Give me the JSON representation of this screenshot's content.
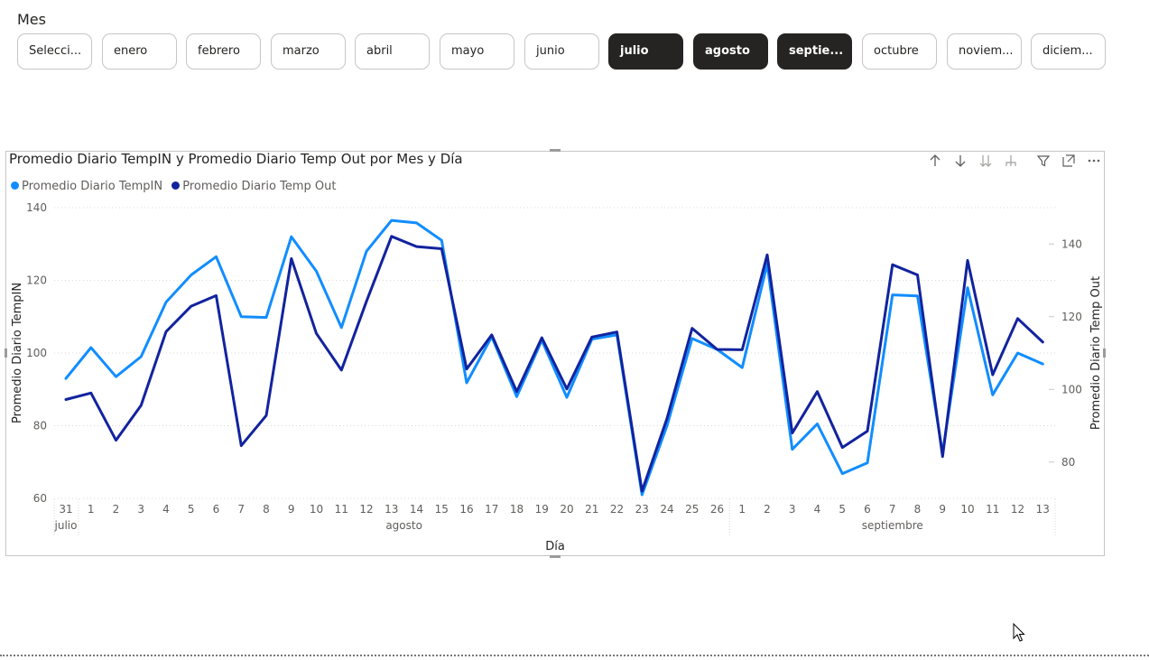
{
  "slicer": {
    "title": "Mes",
    "items": [
      {
        "label": "Selecci...",
        "selected": false
      },
      {
        "label": "enero",
        "selected": false
      },
      {
        "label": "febrero",
        "selected": false
      },
      {
        "label": "marzo",
        "selected": false
      },
      {
        "label": "abril",
        "selected": false
      },
      {
        "label": "mayo",
        "selected": false
      },
      {
        "label": "junio",
        "selected": false
      },
      {
        "label": "julio",
        "selected": true
      },
      {
        "label": "agosto",
        "selected": true
      },
      {
        "label": "septie...",
        "selected": true
      },
      {
        "label": "octubre",
        "selected": false
      },
      {
        "label": "noviem...",
        "selected": false
      },
      {
        "label": "diciem...",
        "selected": false
      }
    ]
  },
  "toolbar_icons": [
    "arrow-up-icon",
    "arrow-down-icon",
    "double-arrow-down-icon",
    "expand-hierarchy-icon",
    "filter-icon",
    "focus-mode-icon",
    "more-options-icon"
  ],
  "chart_data": {
    "type": "line",
    "title": "Promedio Diario TempIN y Promedio Diario Temp Out por Mes y Día",
    "xlabel": "Día",
    "ylabel": "Promedio Diario TempIN",
    "y2label": "Promedio Diario Temp Out",
    "ylim": [
      60,
      140
    ],
    "y2lim": [
      70,
      150
    ],
    "yticks": [
      60,
      80,
      100,
      120,
      140
    ],
    "y2ticks": [
      80,
      100,
      120,
      140
    ],
    "grid": true,
    "legend": "top-left",
    "categories": [
      "31",
      "1",
      "2",
      "3",
      "4",
      "5",
      "6",
      "7",
      "8",
      "9",
      "10",
      "11",
      "12",
      "13",
      "14",
      "15",
      "16",
      "17",
      "18",
      "19",
      "20",
      "21",
      "22",
      "23",
      "24",
      "25",
      "26",
      "1",
      "2",
      "3",
      "4",
      "5",
      "6",
      "7",
      "8",
      "9",
      "10",
      "11",
      "12",
      "13"
    ],
    "groups": [
      {
        "label": "julio",
        "start": 0,
        "end": 0
      },
      {
        "label": "agosto",
        "start": 1,
        "end": 26
      },
      {
        "label": "septiembre",
        "start": 27,
        "end": 39
      }
    ],
    "series": [
      {
        "name": "Promedio Diario TempIN",
        "axis": "left",
        "color": "#118dff",
        "values": [
          93,
          101.5,
          93.5,
          99,
          114,
          121.5,
          126.5,
          110,
          109.8,
          132,
          122.5,
          107,
          128,
          136.5,
          135.8,
          131,
          91.8,
          104.5,
          88,
          103.5,
          87.8,
          103.8,
          105,
          61,
          80,
          104,
          101,
          96,
          124.5,
          73.5,
          80.5,
          66.8,
          69.8,
          116,
          115.7,
          72.5,
          118,
          88.5,
          100,
          97
        ]
      },
      {
        "name": "Promedio Diario Temp Out",
        "axis": "right",
        "color": "#12239e",
        "values": [
          97.2,
          99,
          86,
          95.6,
          115.9,
          122.9,
          125.8,
          84.5,
          92.8,
          136,
          115.4,
          105.3,
          124.2,
          142.1,
          139.3,
          138.7,
          105.6,
          115,
          99.4,
          114.2,
          100.1,
          114.4,
          115.8,
          72,
          92,
          116.8,
          111,
          110.9,
          137,
          88,
          99.4,
          84,
          88.5,
          134.3,
          131.5,
          81.5,
          135.5,
          104,
          119.5,
          113
        ]
      }
    ]
  }
}
